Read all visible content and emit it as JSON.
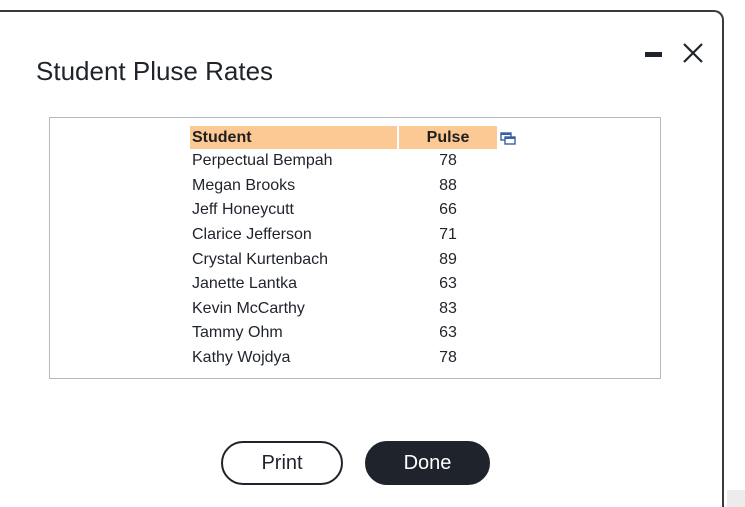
{
  "dialog": {
    "title": "Student Pluse Rates",
    "minimize_icon": "minimize-icon",
    "close_icon": "close-icon"
  },
  "table": {
    "columns": [
      "Student",
      "Pulse"
    ],
    "header_color": "#fcc894",
    "copy_icon": "copy-icon",
    "rows": [
      {
        "student": "Perpectual Bempah",
        "pulse": "78"
      },
      {
        "student": "Megan Brooks",
        "pulse": "88"
      },
      {
        "student": "Jeff Honeycutt",
        "pulse": "66"
      },
      {
        "student": "Clarice Jefferson",
        "pulse": "71"
      },
      {
        "student": "Crystal Kurtenbach",
        "pulse": "89"
      },
      {
        "student": "Janette Lantka",
        "pulse": "63"
      },
      {
        "student": "Kevin McCarthy",
        "pulse": "83"
      },
      {
        "student": "Tammy Ohm",
        "pulse": "63"
      },
      {
        "student": "Kathy Wojdya",
        "pulse": "78"
      }
    ]
  },
  "buttons": {
    "print_label": "Print",
    "done_label": "Done",
    "done_color": "#1f232b"
  }
}
